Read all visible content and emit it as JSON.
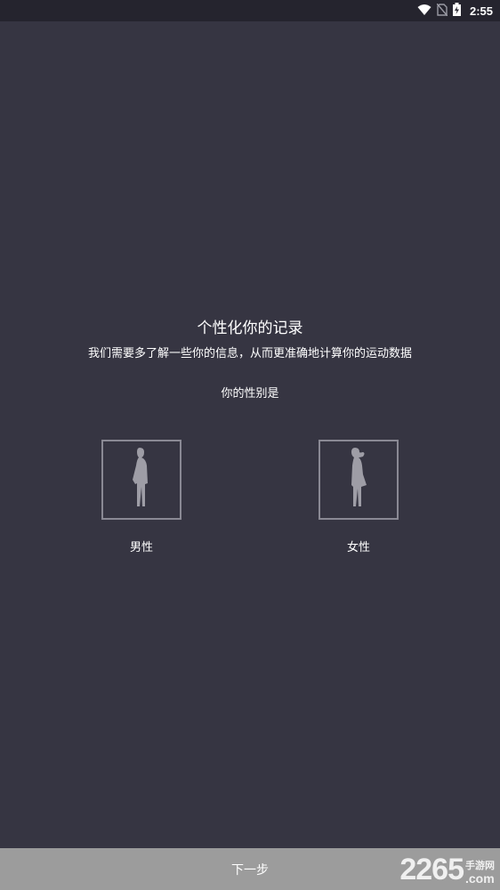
{
  "status_bar": {
    "time": "2:55",
    "icons": [
      "wifi-icon",
      "no-sim-icon",
      "battery-charging-icon"
    ]
  },
  "main": {
    "title": "个性化你的记录",
    "subtitle": "我们需要多了解一些你的信息，从而更准确地计算你的运动数据",
    "question": "你的性别是",
    "options": [
      {
        "label": "男性",
        "icon": "male-figure-icon"
      },
      {
        "label": "女性",
        "icon": "female-figure-icon"
      }
    ]
  },
  "footer": {
    "next_label": "下一步"
  },
  "watermark": {
    "number": "2265",
    "site_cn": "手游网",
    "domain": ".com"
  },
  "colors": {
    "background": "#363542",
    "status_bar": "#25242e",
    "footer": "#9c9c9c",
    "box_border": "#8a8994",
    "figure": "#9e9da6"
  }
}
